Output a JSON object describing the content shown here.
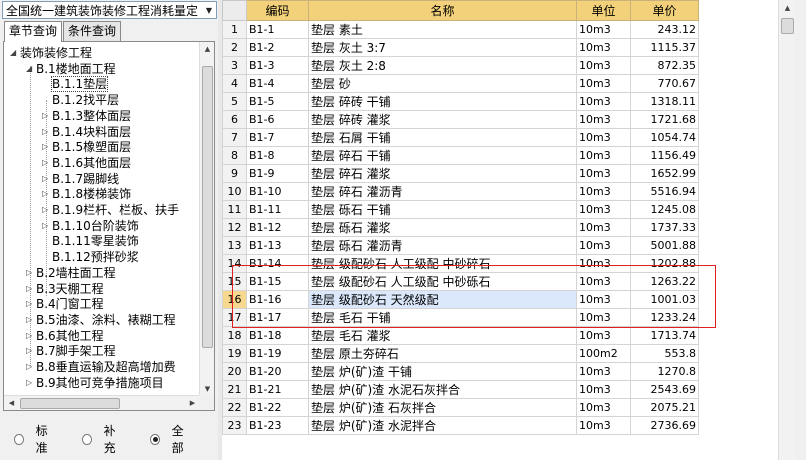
{
  "quota_selector": {
    "value": "全国统一建筑装饰装修工程消耗量定",
    "arrow_icon": "chevron-down-icon"
  },
  "tabs": [
    {
      "label": "章节查询",
      "active": true
    },
    {
      "label": "条件查询",
      "active": false
    }
  ],
  "tree": [
    {
      "label": "装饰装修工程",
      "toggle": "-",
      "level": 0
    },
    {
      "label": "B.1楼地面工程",
      "toggle": "-",
      "level": 1
    },
    {
      "label": "B.1.1垫层",
      "toggle": "",
      "level": 2,
      "selected": true
    },
    {
      "label": "B.1.2找平层",
      "toggle": "",
      "level": 2
    },
    {
      "label": "B.1.3整体面层",
      "toggle": "▸",
      "level": 2
    },
    {
      "label": "B.1.4块料面层",
      "toggle": "▸",
      "level": 2
    },
    {
      "label": "B.1.5橡塑面层",
      "toggle": "▸",
      "level": 2
    },
    {
      "label": "B.1.6其他面层",
      "toggle": "▸",
      "level": 2
    },
    {
      "label": "B.1.7踢脚线",
      "toggle": "▸",
      "level": 2
    },
    {
      "label": "B.1.8楼梯装饰",
      "toggle": "▸",
      "level": 2
    },
    {
      "label": "B.1.9栏杆、栏板、扶手",
      "toggle": "▸",
      "level": 2
    },
    {
      "label": "B.1.10台阶装饰",
      "toggle": "▸",
      "level": 2
    },
    {
      "label": "B.1.11零星装饰",
      "toggle": "",
      "level": 2
    },
    {
      "label": "B.1.12预拌砂浆",
      "toggle": "",
      "level": 2
    },
    {
      "label": "B.2墙柱面工程",
      "toggle": "▸",
      "level": 1
    },
    {
      "label": "B.3天棚工程",
      "toggle": "▸",
      "level": 1
    },
    {
      "label": "B.4门窗工程",
      "toggle": "▸",
      "level": 1
    },
    {
      "label": "B.5油漆、涂料、裱糊工程",
      "toggle": "▸",
      "level": 1
    },
    {
      "label": "B.6其他工程",
      "toggle": "▸",
      "level": 1
    },
    {
      "label": "B.7脚手架工程",
      "toggle": "▸",
      "level": 1
    },
    {
      "label": "B.8垂直运输及超高增加费",
      "toggle": "▸",
      "level": 1
    },
    {
      "label": "B.9其他可竞争措施项目",
      "toggle": "▸",
      "level": 1
    }
  ],
  "filter": [
    {
      "label": "标准",
      "checked": false
    },
    {
      "label": "补充",
      "checked": false
    },
    {
      "label": "全部",
      "checked": true
    }
  ],
  "grid": {
    "headers": {
      "no": "",
      "code": "编码",
      "name": "名称",
      "unit": "单位",
      "price": "单价"
    },
    "current_row": 16,
    "highlighted_rows": [
      14,
      15,
      16
    ],
    "rows": [
      {
        "no": "1",
        "code": "B1-1",
        "name": "垫层 素土",
        "unit": "10m3",
        "price": "243.12"
      },
      {
        "no": "2",
        "code": "B1-2",
        "name": "垫层 灰土 3:7",
        "unit": "10m3",
        "price": "1115.37"
      },
      {
        "no": "3",
        "code": "B1-3",
        "name": "垫层 灰土 2:8",
        "unit": "10m3",
        "price": "872.35"
      },
      {
        "no": "4",
        "code": "B1-4",
        "name": "垫层 砂",
        "unit": "10m3",
        "price": "770.67"
      },
      {
        "no": "5",
        "code": "B1-5",
        "name": "垫层 碎砖 干铺",
        "unit": "10m3",
        "price": "1318.11"
      },
      {
        "no": "6",
        "code": "B1-6",
        "name": "垫层 碎砖 灌浆",
        "unit": "10m3",
        "price": "1721.68"
      },
      {
        "no": "7",
        "code": "B1-7",
        "name": "垫层 石屑 干铺",
        "unit": "10m3",
        "price": "1054.74"
      },
      {
        "no": "8",
        "code": "B1-8",
        "name": "垫层 碎石 干铺",
        "unit": "10m3",
        "price": "1156.49"
      },
      {
        "no": "9",
        "code": "B1-9",
        "name": "垫层 碎石 灌浆",
        "unit": "10m3",
        "price": "1652.99"
      },
      {
        "no": "10",
        "code": "B1-10",
        "name": "垫层 碎石 灌沥青",
        "unit": "10m3",
        "price": "5516.94"
      },
      {
        "no": "11",
        "code": "B1-11",
        "name": "垫层 砾石 干铺",
        "unit": "10m3",
        "price": "1245.08"
      },
      {
        "no": "12",
        "code": "B1-12",
        "name": "垫层 砾石 灌浆",
        "unit": "10m3",
        "price": "1737.33"
      },
      {
        "no": "13",
        "code": "B1-13",
        "name": "垫层 砾石 灌沥青",
        "unit": "10m3",
        "price": "5001.88"
      },
      {
        "no": "14",
        "code": "B1-14",
        "name": "垫层 级配砂石 人工级配 中砂碎石",
        "unit": "10m3",
        "price": "1202.88"
      },
      {
        "no": "15",
        "code": "B1-15",
        "name": "垫层 级配砂石 人工级配 中砂砾石",
        "unit": "10m3",
        "price": "1263.22"
      },
      {
        "no": "16",
        "code": "B1-16",
        "name": "垫层 级配砂石 天然级配",
        "unit": "10m3",
        "price": "1001.03"
      },
      {
        "no": "17",
        "code": "B1-17",
        "name": "垫层 毛石 干铺",
        "unit": "10m3",
        "price": "1233.24"
      },
      {
        "no": "18",
        "code": "B1-18",
        "name": "垫层 毛石 灌浆",
        "unit": "10m3",
        "price": "1713.74"
      },
      {
        "no": "19",
        "code": "B1-19",
        "name": "垫层 原土夯碎石",
        "unit": "100m2",
        "price": "553.8"
      },
      {
        "no": "20",
        "code": "B1-20",
        "name": "垫层 炉(矿)渣 干铺",
        "unit": "10m3",
        "price": "1270.8"
      },
      {
        "no": "21",
        "code": "B1-21",
        "name": "垫层 炉(矿)渣 水泥石灰拌合",
        "unit": "10m3",
        "price": "2543.69"
      },
      {
        "no": "22",
        "code": "B1-22",
        "name": "垫层 炉(矿)渣 石灰拌合",
        "unit": "10m3",
        "price": "2075.21"
      },
      {
        "no": "23",
        "code": "B1-23",
        "name": "垫层 炉(矿)渣 水泥拌合",
        "unit": "10m3",
        "price": "2736.69"
      }
    ]
  }
}
